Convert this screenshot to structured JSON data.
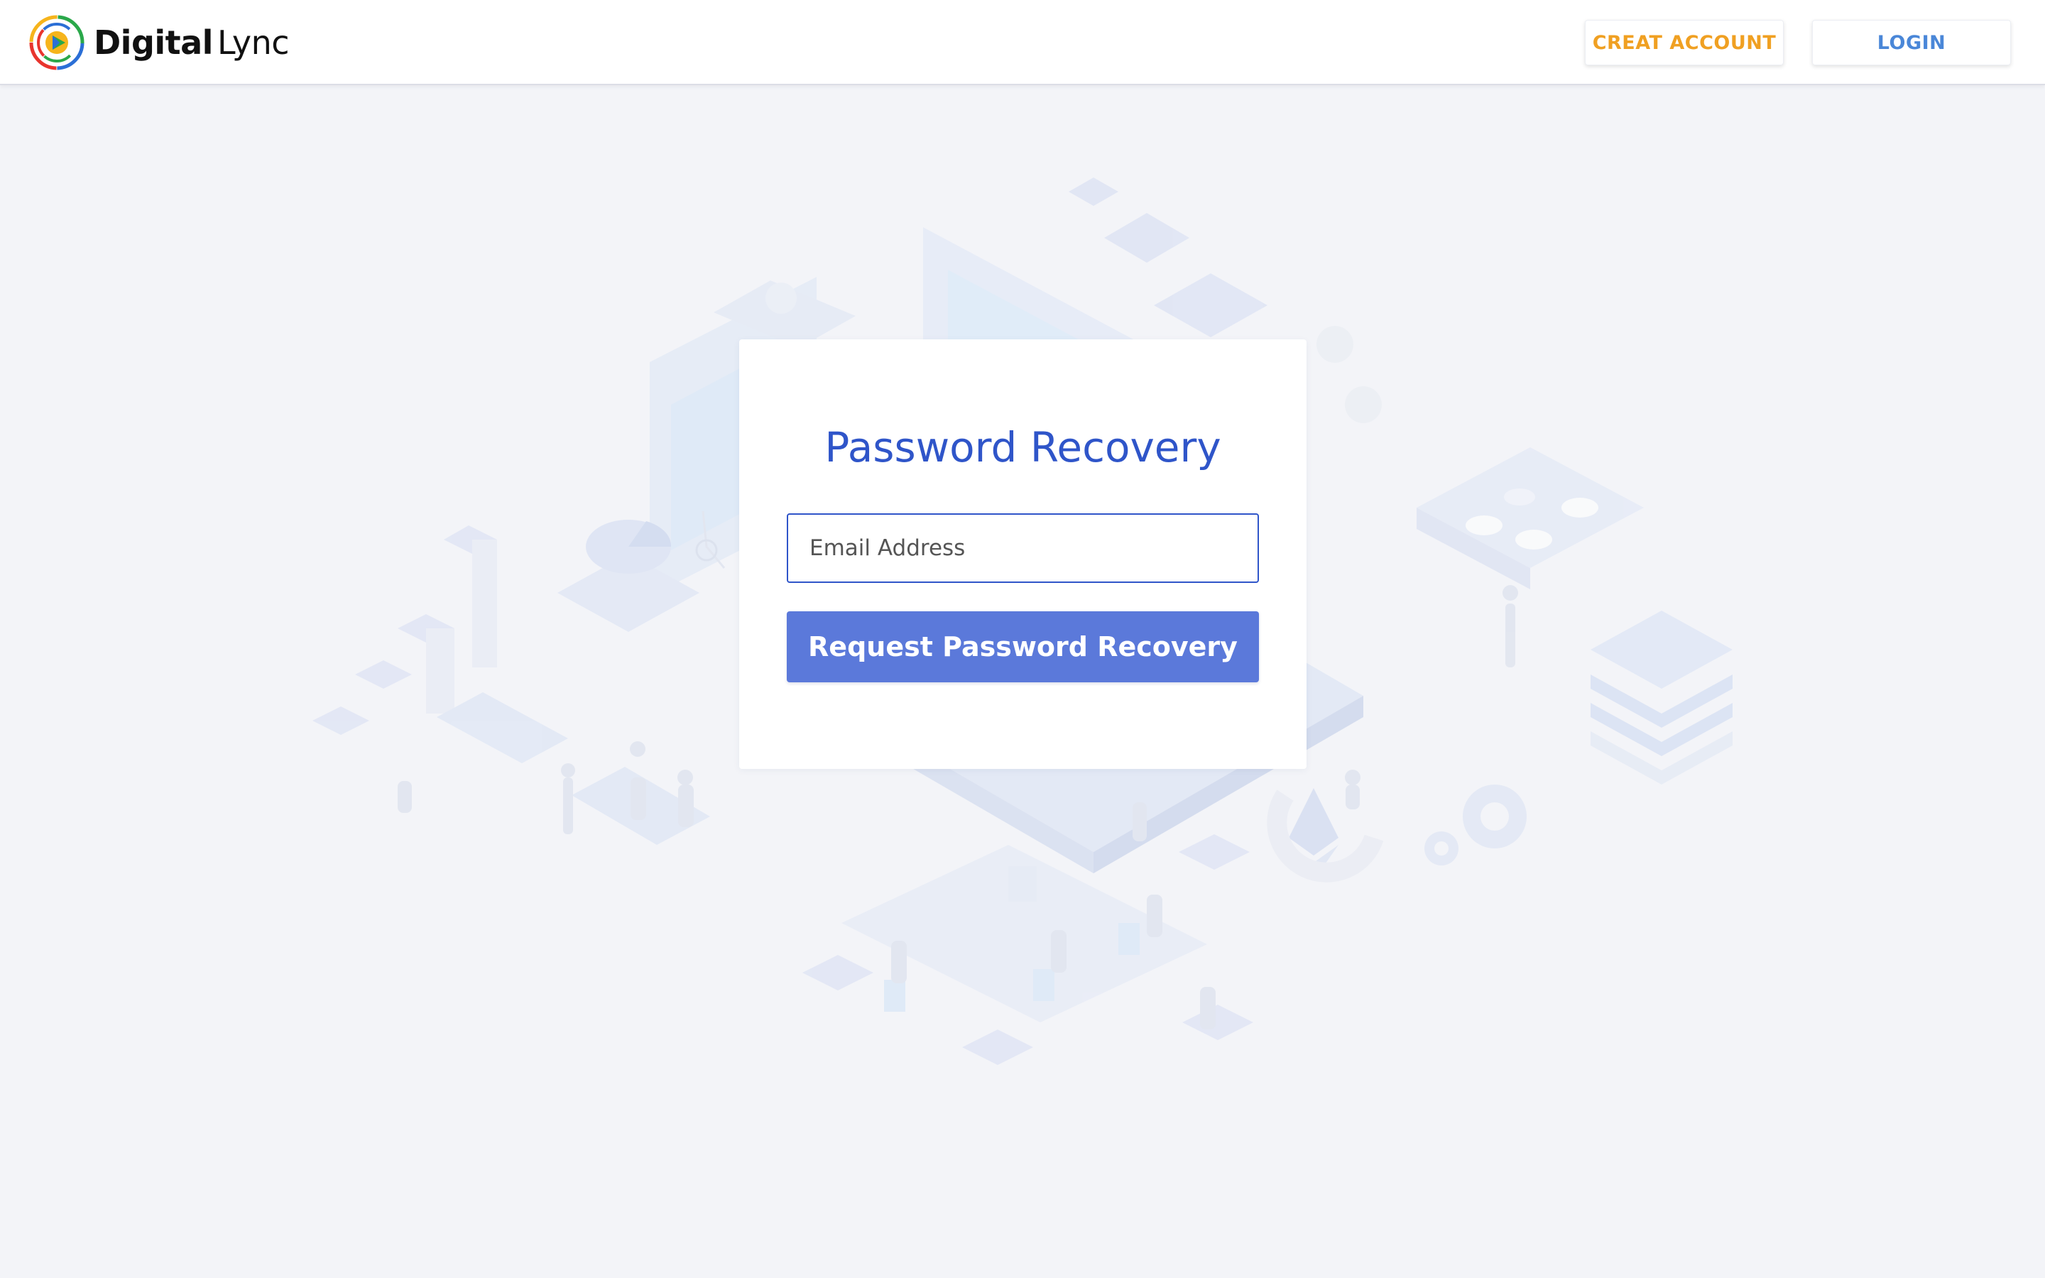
{
  "brand": {
    "name_bold": "Digital",
    "name_light": "Lync",
    "logo_colors": [
      "#e8352e",
      "#f6b41c",
      "#2aa84a",
      "#2b6fd6"
    ]
  },
  "header": {
    "create_account_label": "CREAT ACCOUNT",
    "login_label": "LOGIN"
  },
  "recovery_form": {
    "title": "Password Recovery",
    "email_placeholder": "Email Address",
    "email_value": "",
    "submit_label": "Request Password Recovery"
  },
  "colors": {
    "accent": "#2f55c9",
    "button": "#5b79da",
    "create_account": "#f0a022",
    "login": "#4a87d8",
    "background": "#f3f4f8"
  }
}
